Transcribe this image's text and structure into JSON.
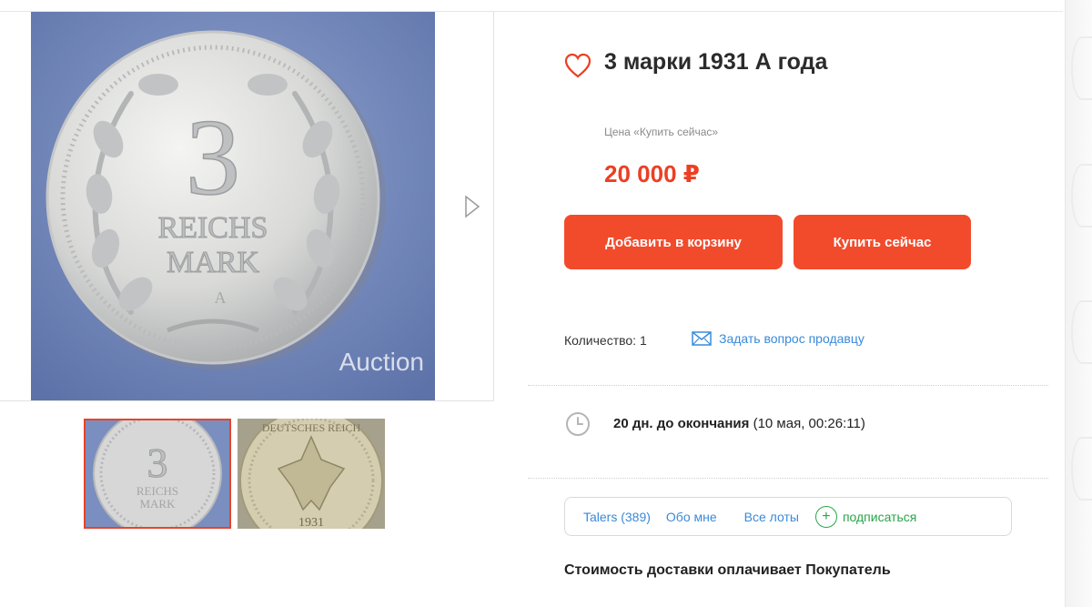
{
  "gallery": {
    "watermark": "Auction",
    "coin_denomination": "3",
    "coin_text_line1": "REICHS",
    "coin_text_line2": "MARK",
    "coin_mint": "A",
    "thumb2_legend": "DEUTSCHES REICH",
    "thumb2_year": "1931"
  },
  "product": {
    "title": "3 марки 1931 А года",
    "price_label": "Цена «Купить сейчас»",
    "price": "20 000 ₽"
  },
  "actions": {
    "add_to_cart": "Добавить в корзину",
    "buy_now": "Купить сейчас"
  },
  "quantity": {
    "label": "Количество: 1"
  },
  "ask_seller": "Задать вопрос продавцу",
  "timer": {
    "remaining": "20 дн. до окончания",
    "end_time": "(10 мая, 00:26:11)"
  },
  "seller": {
    "name_link": "Talers (389)",
    "about": "Обо мне",
    "all_lots": "Все лоты",
    "subscribe": "подписаться"
  },
  "delivery_note": "Стоимость доставки оплачивает Покупатель",
  "colors": {
    "accent": "#f24b2c",
    "price": "#ec3f23",
    "link": "#3a8ad9",
    "subscribe": "#2ba44a",
    "thumb_selected_border": "#e8432c"
  },
  "icons": {
    "favorite": "heart-icon",
    "expand": "expand-icon",
    "next": "chevron-right-icon",
    "mail": "mail-icon",
    "clock": "clock-icon",
    "subscribe": "plus-circle-icon"
  }
}
